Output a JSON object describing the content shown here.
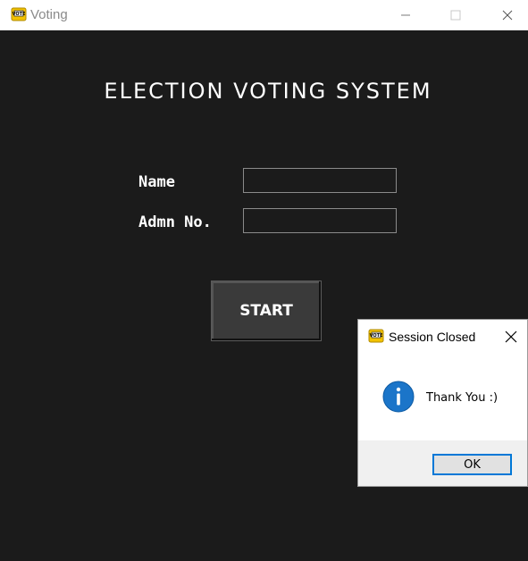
{
  "window": {
    "title": "Voting",
    "icon": "vote-app-icon",
    "controls": [
      "minimize-icon",
      "maximize-icon",
      "close-icon"
    ]
  },
  "main": {
    "heading": "ELECTION VOTING SYSTEM",
    "fields": [
      {
        "label": "Name",
        "value": ""
      },
      {
        "label": "Admn No.",
        "value": ""
      }
    ],
    "start_label": "START"
  },
  "dialog": {
    "title": "Session Closed",
    "icon": "info-icon",
    "message": "Thank You :)",
    "ok_label": "OK"
  },
  "colors": {
    "background": "#1b1b1b",
    "accent": "#0078d7",
    "info_icon": "#1b75c9"
  }
}
